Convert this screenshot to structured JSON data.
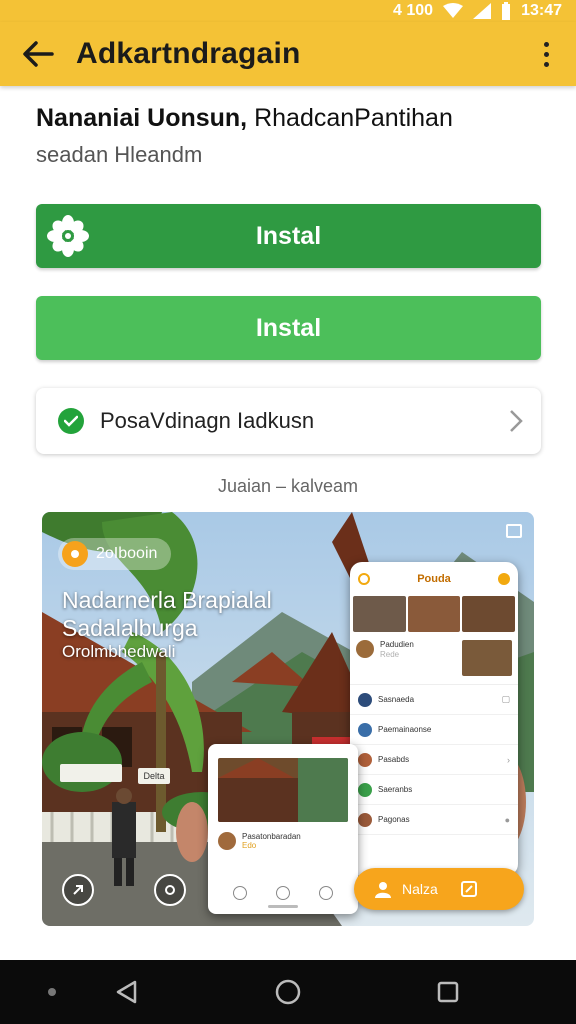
{
  "status_bar": {
    "time": "13:47",
    "signal_label": "4 100"
  },
  "app_bar": {
    "title": "Adkartndragain"
  },
  "heading": {
    "bold": "Nananiai Uonsun,",
    "regular": " RhadcanPantihan"
  },
  "subheading": "seadan Hleandm",
  "buttons": [
    {
      "label": "Instal",
      "color": "#2f9a42"
    },
    {
      "label": "Instal",
      "color": "#4cbf5a"
    }
  ],
  "verified_card": {
    "label": "PosaVdinagn Iadkusn"
  },
  "caption": "Juaian – kalveam",
  "hero": {
    "chip": "2oIbooin",
    "title_line1": "Nadarnerla Brapialal",
    "title_line2": "Sadalalburga",
    "subtitle": "Orolmbhedwali",
    "sign_left": "",
    "sign_small": "Delta",
    "phone": {
      "title": "Pouda",
      "feature_title": "Padudien",
      "feature_sub": "Rede",
      "rows": [
        "Sasnaeda",
        "Paemainaonse",
        "Pasabds",
        "Saeranbs",
        "Pagonas"
      ]
    },
    "small_phone": {
      "row_label": "Pasatonbaradan",
      "row_sub": "Edo"
    },
    "fab_label": "Nalza"
  },
  "colors": {
    "accent_yellow": "#f4c236",
    "primary_green": "#2f9a42",
    "light_green": "#4cbf5a",
    "orange": "#f7a51c"
  }
}
